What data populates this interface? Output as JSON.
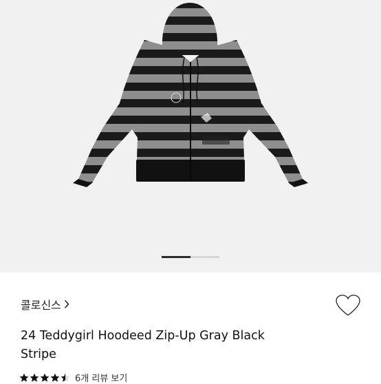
{
  "gallery": {
    "image_icon": "striped-zip-up-hoodie-photo",
    "page_indicator": {
      "current": 1,
      "total": 2
    },
    "colors": {
      "background": "#f1f1f1",
      "stripe_dark": "#1a1a1a",
      "stripe_light": "#8e8e8e"
    }
  },
  "product": {
    "brand": "콜로신스",
    "brand_chevron_icon": "chevron-right-icon",
    "like_icon": "heart-outline-icon",
    "title_line1": "24 Teddygirl Hoodeed Zip-Up Gray  Black",
    "title_line2": "Stripe",
    "rating": {
      "stars": 4.5,
      "max": 5,
      "star_color": "#111111"
    },
    "review_link": "6개 리뷰 보기"
  }
}
